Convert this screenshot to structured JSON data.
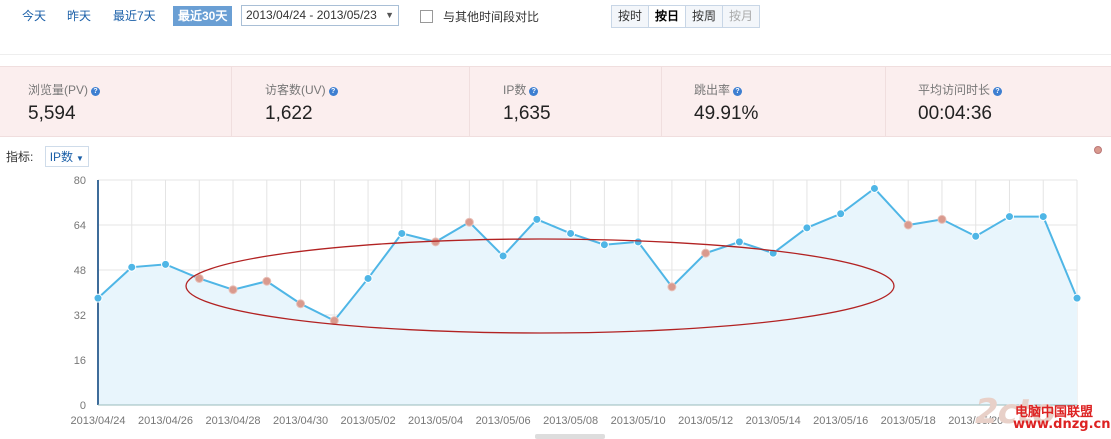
{
  "toolbar": {
    "range_buttons": [
      "今天",
      "昨天",
      "最近7天",
      "最近30天"
    ],
    "active_range": "最近30天",
    "date_range": "2013/04/24 - 2013/05/23",
    "compare_label": "与其他时间段对比",
    "granularity": [
      "按时",
      "按日",
      "按周",
      "按月"
    ],
    "active_granularity": "按日",
    "disabled_granularity": "按月"
  },
  "metrics": [
    {
      "label": "浏览量(PV)",
      "value": "5,594"
    },
    {
      "label": "访客数(UV)",
      "value": "1,622"
    },
    {
      "label": "IP数",
      "value": "1,635"
    },
    {
      "label": "跳出率",
      "value": "49.91%"
    },
    {
      "label": "平均访问时长",
      "value": "00:04:36"
    }
  ],
  "indicator": {
    "label": "指标:",
    "selected": "IP数"
  },
  "colors": {
    "line": "#4fb6e6",
    "fill": "#e8f5fc",
    "highlight_point": "#d99a8e",
    "ellipse": "#b22222",
    "accent": "#6a9fd4"
  },
  "chart_data": {
    "type": "area",
    "ylim": [
      0,
      80
    ],
    "yticks": [
      0,
      16,
      32,
      48,
      64,
      80
    ],
    "x_tick_labels": [
      "2013/04/24",
      "2013/04/26",
      "2013/04/28",
      "2013/04/30",
      "2013/05/02",
      "2013/05/04",
      "2013/05/06",
      "2013/05/08",
      "2013/05/10",
      "2013/05/12",
      "2013/05/14",
      "2013/05/16",
      "2013/05/18",
      "2013/05/20"
    ],
    "x": [
      "2013/04/24",
      "2013/04/25",
      "2013/04/26",
      "2013/04/27",
      "2013/04/28",
      "2013/04/29",
      "2013/04/30",
      "2013/05/01",
      "2013/05/02",
      "2013/05/03",
      "2013/05/04",
      "2013/05/05",
      "2013/05/06",
      "2013/05/07",
      "2013/05/08",
      "2013/05/09",
      "2013/05/10",
      "2013/05/11",
      "2013/05/12",
      "2013/05/13",
      "2013/05/14",
      "2013/05/15",
      "2013/05/16",
      "2013/05/17",
      "2013/05/18",
      "2013/05/19",
      "2013/05/20",
      "2013/05/21",
      "2013/05/22",
      "2013/05/23"
    ],
    "series": [
      {
        "values": [
          38,
          49,
          50,
          45,
          41,
          44,
          36,
          30,
          45,
          61,
          58,
          65,
          53,
          66,
          61,
          57,
          58,
          42,
          54,
          58,
          54,
          63,
          68,
          77,
          64,
          66,
          60,
          67,
          67,
          38
        ]
      }
    ],
    "highlighted_points": [
      3,
      4,
      5,
      6,
      7,
      10,
      11,
      17,
      18,
      24,
      25
    ],
    "grid": true,
    "legend_placement": "top-right",
    "annotation": "red ellipse around 2013/04/27 - 2013/05/13"
  },
  "watermark": {
    "big": "2cto",
    "name": "电脑中国联盟",
    "url": "www.dnzg.cn"
  }
}
